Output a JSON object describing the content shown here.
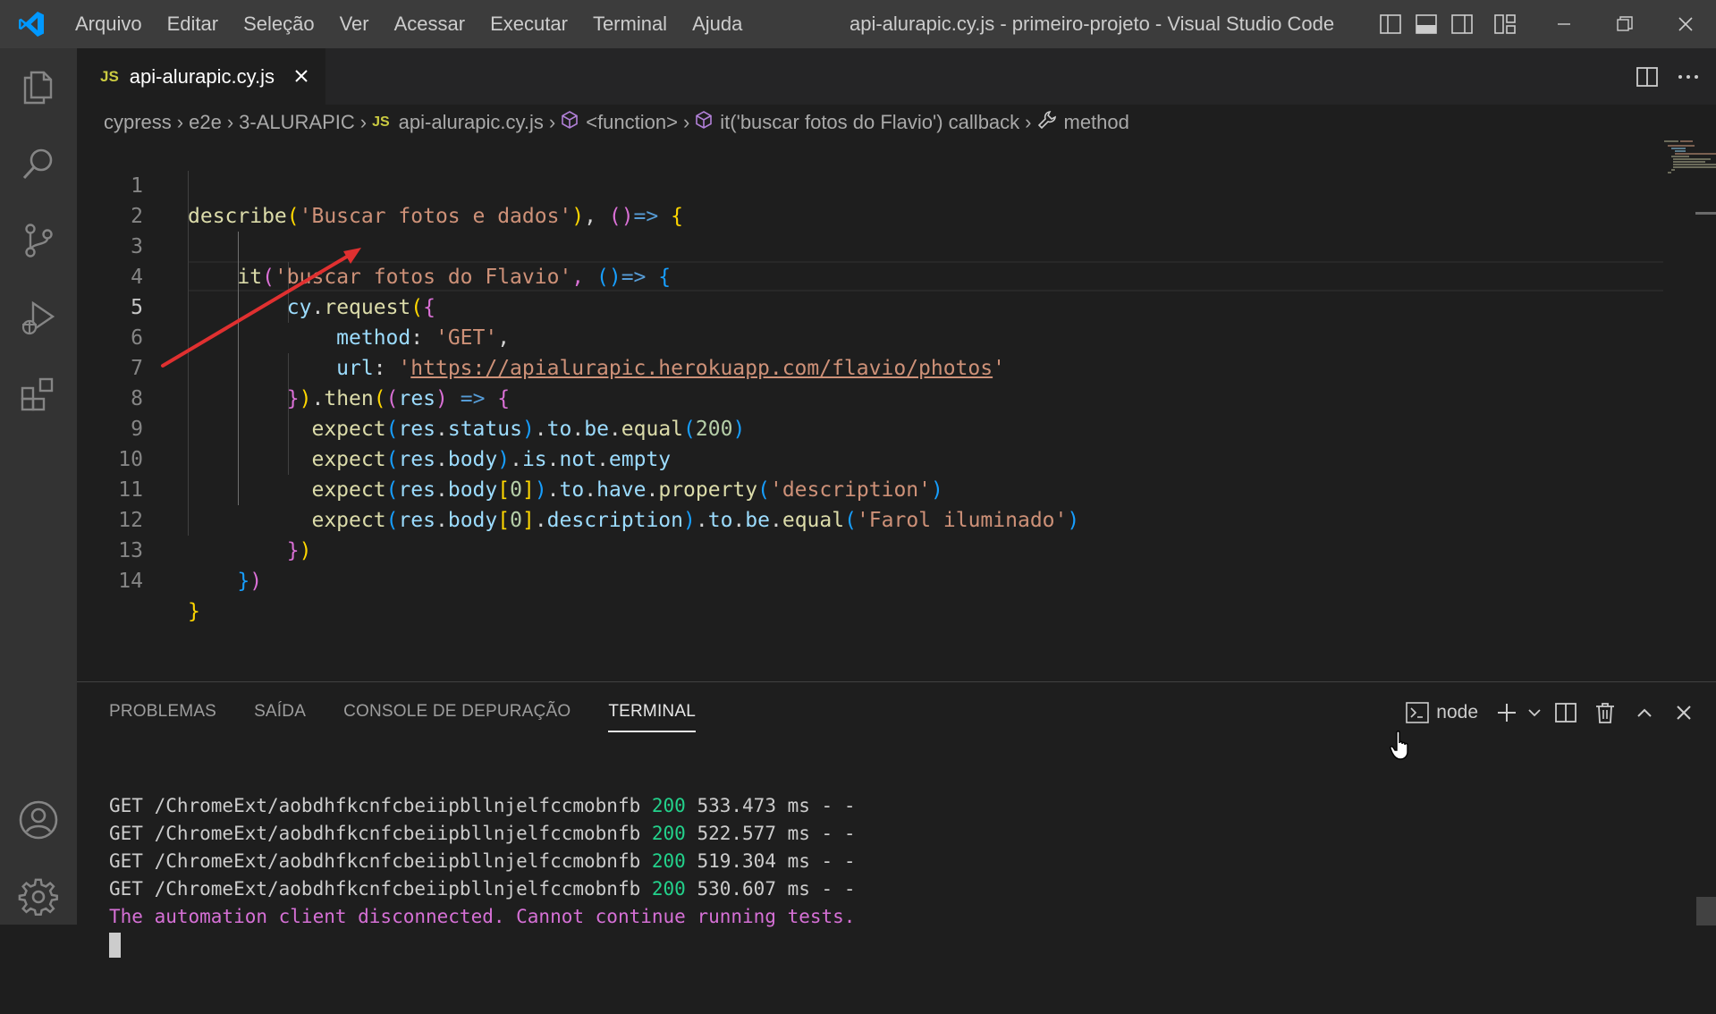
{
  "window": {
    "title": "api-alurapic.cy.js - primeiro-projeto - Visual Studio Code"
  },
  "menu": [
    "Arquivo",
    "Editar",
    "Seleção",
    "Ver",
    "Acessar",
    "Executar",
    "Terminal",
    "Ajuda"
  ],
  "colors": {
    "accent_blue": "#0078d4",
    "terminal_green": "#23d18b",
    "terminal_magenta": "#d670d6",
    "annotation_arrow": "#e03030"
  },
  "tab": {
    "icon": "JS",
    "label": "api-alurapic.cy.js"
  },
  "breadcrumb": {
    "items": [
      "cypress",
      "e2e",
      "3-ALURAPIC",
      "api-alurapic.cy.js",
      "<function>",
      "it('buscar fotos do Flavio') callback",
      "method"
    ]
  },
  "editor": {
    "active_line": 5,
    "line_numbers": [
      "1",
      "2",
      "3",
      "4",
      "5",
      "6",
      "7",
      "8",
      "9",
      "10",
      "11",
      "12",
      "13",
      "14"
    ],
    "code": {
      "l1": [
        "describe",
        "(",
        "'Buscar fotos e dados'",
        ")",
        ", ",
        "()",
        "=>",
        " ",
        "{"
      ],
      "l3": [
        "    ",
        "it",
        "(",
        "'buscar fotos do Flavio'",
        ", ",
        "()",
        "=>",
        " ",
        "{"
      ],
      "l4": [
        "        ",
        "cy",
        ".",
        "request",
        "(",
        "{"
      ],
      "l5": [
        "            ",
        "method",
        ": ",
        "'GET'",
        ","
      ],
      "l6": [
        "            ",
        "url",
        ": ",
        "'",
        "https://apialurapic.herokuapp.com/flavio/photos",
        "'"
      ],
      "l7": [
        "        ",
        "}",
        ")",
        ".",
        "then",
        "(",
        "(",
        "res",
        ")",
        " => ",
        "{"
      ],
      "l8": [
        "          ",
        "expect",
        "(",
        "res",
        ".",
        "status",
        ")",
        ".",
        "to",
        ".",
        "be",
        ".",
        "equal",
        "(",
        "200",
        ")"
      ],
      "l9": [
        "          ",
        "expect",
        "(",
        "res",
        ".",
        "body",
        ")",
        ".",
        "is",
        ".",
        "not",
        ".",
        "empty"
      ],
      "l10": [
        "          ",
        "expect",
        "(",
        "res",
        ".",
        "body",
        "[",
        "0",
        "]",
        ")",
        ".",
        "to",
        ".",
        "have",
        ".",
        "property",
        "(",
        "'description'",
        ")"
      ],
      "l11": [
        "          ",
        "expect",
        "(",
        "res",
        ".",
        "body",
        "[",
        "0",
        "]",
        ".",
        "description",
        ")",
        ".",
        "to",
        ".",
        "be",
        ".",
        "equal",
        "(",
        "'Farol iluminado'",
        ")"
      ],
      "l12": [
        "        ",
        "}",
        ")"
      ],
      "l13": [
        "    ",
        "}",
        ")"
      ],
      "l14": [
        "}"
      ]
    }
  },
  "panel": {
    "tabs": [
      "PROBLEMAS",
      "SAÍDA",
      "CONSOLE DE DEPURAÇÃO",
      "TERMINAL"
    ],
    "active_tab": "TERMINAL",
    "terminal_profile": "node",
    "terminal_lines": [
      {
        "prefix": "GET /ChromeExt/aobdhfkcnfcbeiipbllnjelfccmobnfb ",
        "status": "200",
        "suffix": " 533.473 ms - -"
      },
      {
        "prefix": "GET /ChromeExt/aobdhfkcnfcbeiipbllnjelfccmobnfb ",
        "status": "200",
        "suffix": " 522.577 ms - -"
      },
      {
        "prefix": "GET /ChromeExt/aobdhfkcnfcbeiipbllnjelfccmobnfb ",
        "status": "200",
        "suffix": " 519.304 ms - -"
      },
      {
        "prefix": "GET /ChromeExt/aobdhfkcnfcbeiipbllnjelfccmobnfb ",
        "status": "200",
        "suffix": " 530.607 ms - -"
      }
    ],
    "terminal_error": "The automation client disconnected. Cannot continue running tests."
  },
  "icons": {
    "activity_bar": [
      "explorer-icon",
      "search-icon",
      "source-control-icon",
      "run-debug-icon",
      "extensions-icon",
      "accounts-icon",
      "manage-gear-icon"
    ],
    "title_bar": [
      "toggle-primary-sidebar-icon",
      "toggle-panel-icon",
      "toggle-secondary-sidebar-icon",
      "customize-layout-icon"
    ],
    "editor_actions": [
      "split-editor-icon",
      "more-actions-icon"
    ],
    "panel_actions": [
      "terminal-icon",
      "new-terminal-plus-icon",
      "launch-profile-chevron-icon",
      "split-terminal-icon",
      "kill-terminal-trash-icon",
      "maximize-panel-chevron-up-icon",
      "close-panel-icon"
    ]
  }
}
